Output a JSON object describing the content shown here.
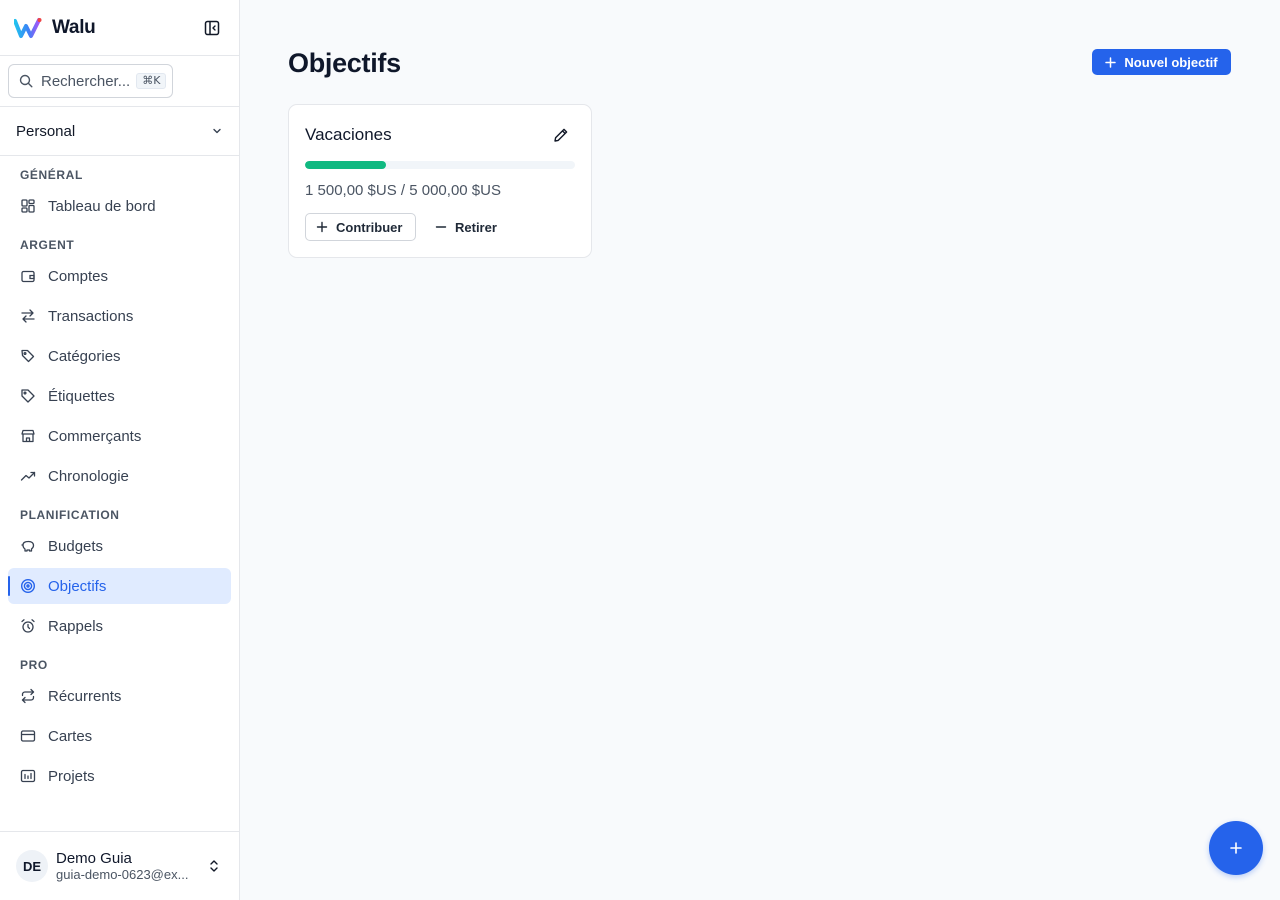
{
  "app": {
    "name": "Walu"
  },
  "search": {
    "placeholder": "Rechercher...",
    "shortcut": "⌘K"
  },
  "workspace": {
    "selected": "Personal"
  },
  "nav": {
    "sections": [
      {
        "title": "GÉNÉRAL",
        "items": [
          {
            "label": "Tableau de bord",
            "icon": "dashboard-icon"
          }
        ]
      },
      {
        "title": "ARGENT",
        "items": [
          {
            "label": "Comptes",
            "icon": "wallet-icon"
          },
          {
            "label": "Transactions",
            "icon": "arrows-swap-icon"
          },
          {
            "label": "Catégories",
            "icon": "tags-icon"
          },
          {
            "label": "Étiquettes",
            "icon": "tag-icon"
          },
          {
            "label": "Commerçants",
            "icon": "store-icon"
          },
          {
            "label": "Chronologie",
            "icon": "trend-icon"
          }
        ]
      },
      {
        "title": "PLANIFICATION",
        "items": [
          {
            "label": "Budgets",
            "icon": "piggy-bank-icon"
          },
          {
            "label": "Objectifs",
            "icon": "target-icon",
            "active": true
          },
          {
            "label": "Rappels",
            "icon": "alarm-icon"
          }
        ]
      },
      {
        "title": "PRO",
        "items": [
          {
            "label": "Récurrents",
            "icon": "repeat-icon"
          },
          {
            "label": "Cartes",
            "icon": "card-icon"
          },
          {
            "label": "Projets",
            "icon": "chart-folder-icon"
          }
        ]
      }
    ]
  },
  "user": {
    "initials": "DE",
    "name": "Demo Guia",
    "email": "guia-demo-0623@ex..."
  },
  "page": {
    "title": "Objectifs",
    "new_goal_label": "Nouvel objectif"
  },
  "goals": [
    {
      "name": "Vacaciones",
      "saved": "1 500,00 $US",
      "target": "5 000,00 $US",
      "amount_text": "1 500,00 $US / 5 000,00 $US",
      "progress": 0.3,
      "contribute_label": "Contribuer",
      "withdraw_label": "Retirer"
    }
  ],
  "colors": {
    "accent": "#2563eb",
    "progress": "#10b981",
    "active_bg": "#e0ebff"
  }
}
